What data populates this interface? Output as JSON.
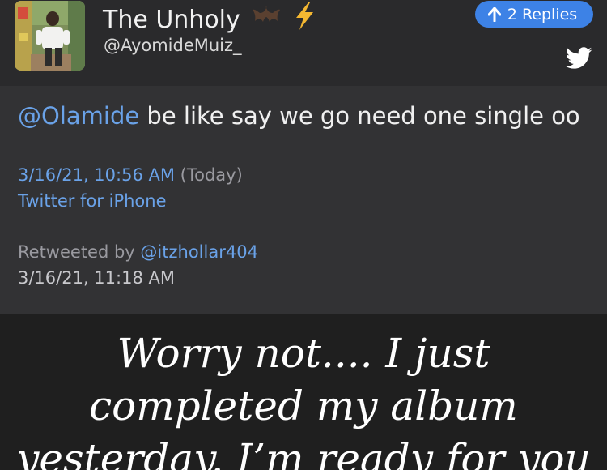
{
  "tweet": {
    "display_name": "The Unholy",
    "handle": "@AyomideMuiz_",
    "avatar_icon": "profile-photo",
    "emojis": [
      "bat-icon",
      "lightning-icon"
    ],
    "replies_label": "2 Replies",
    "mention": "@Olamide",
    "text": " be like say we go need one single oo",
    "timestamp": "3/16/21, 10:56 AM",
    "timestamp_note": "(Today)",
    "source": "Twitter for iPhone",
    "retweeted_by_label": "Retweeted by ",
    "retweeted_by_handle": "@itzhollar404",
    "retweet_timestamp": "3/16/21, 11:18 AM"
  },
  "caption": {
    "line1": "Worry not.... I just",
    "line2": "completed my album",
    "line3": "yesterday. I’m ready for you"
  },
  "colors": {
    "accent_blue": "#3d82e6",
    "link_blue": "#6aa2e8",
    "background": "#2a2a2c",
    "tweet_body_background": "#323234"
  }
}
